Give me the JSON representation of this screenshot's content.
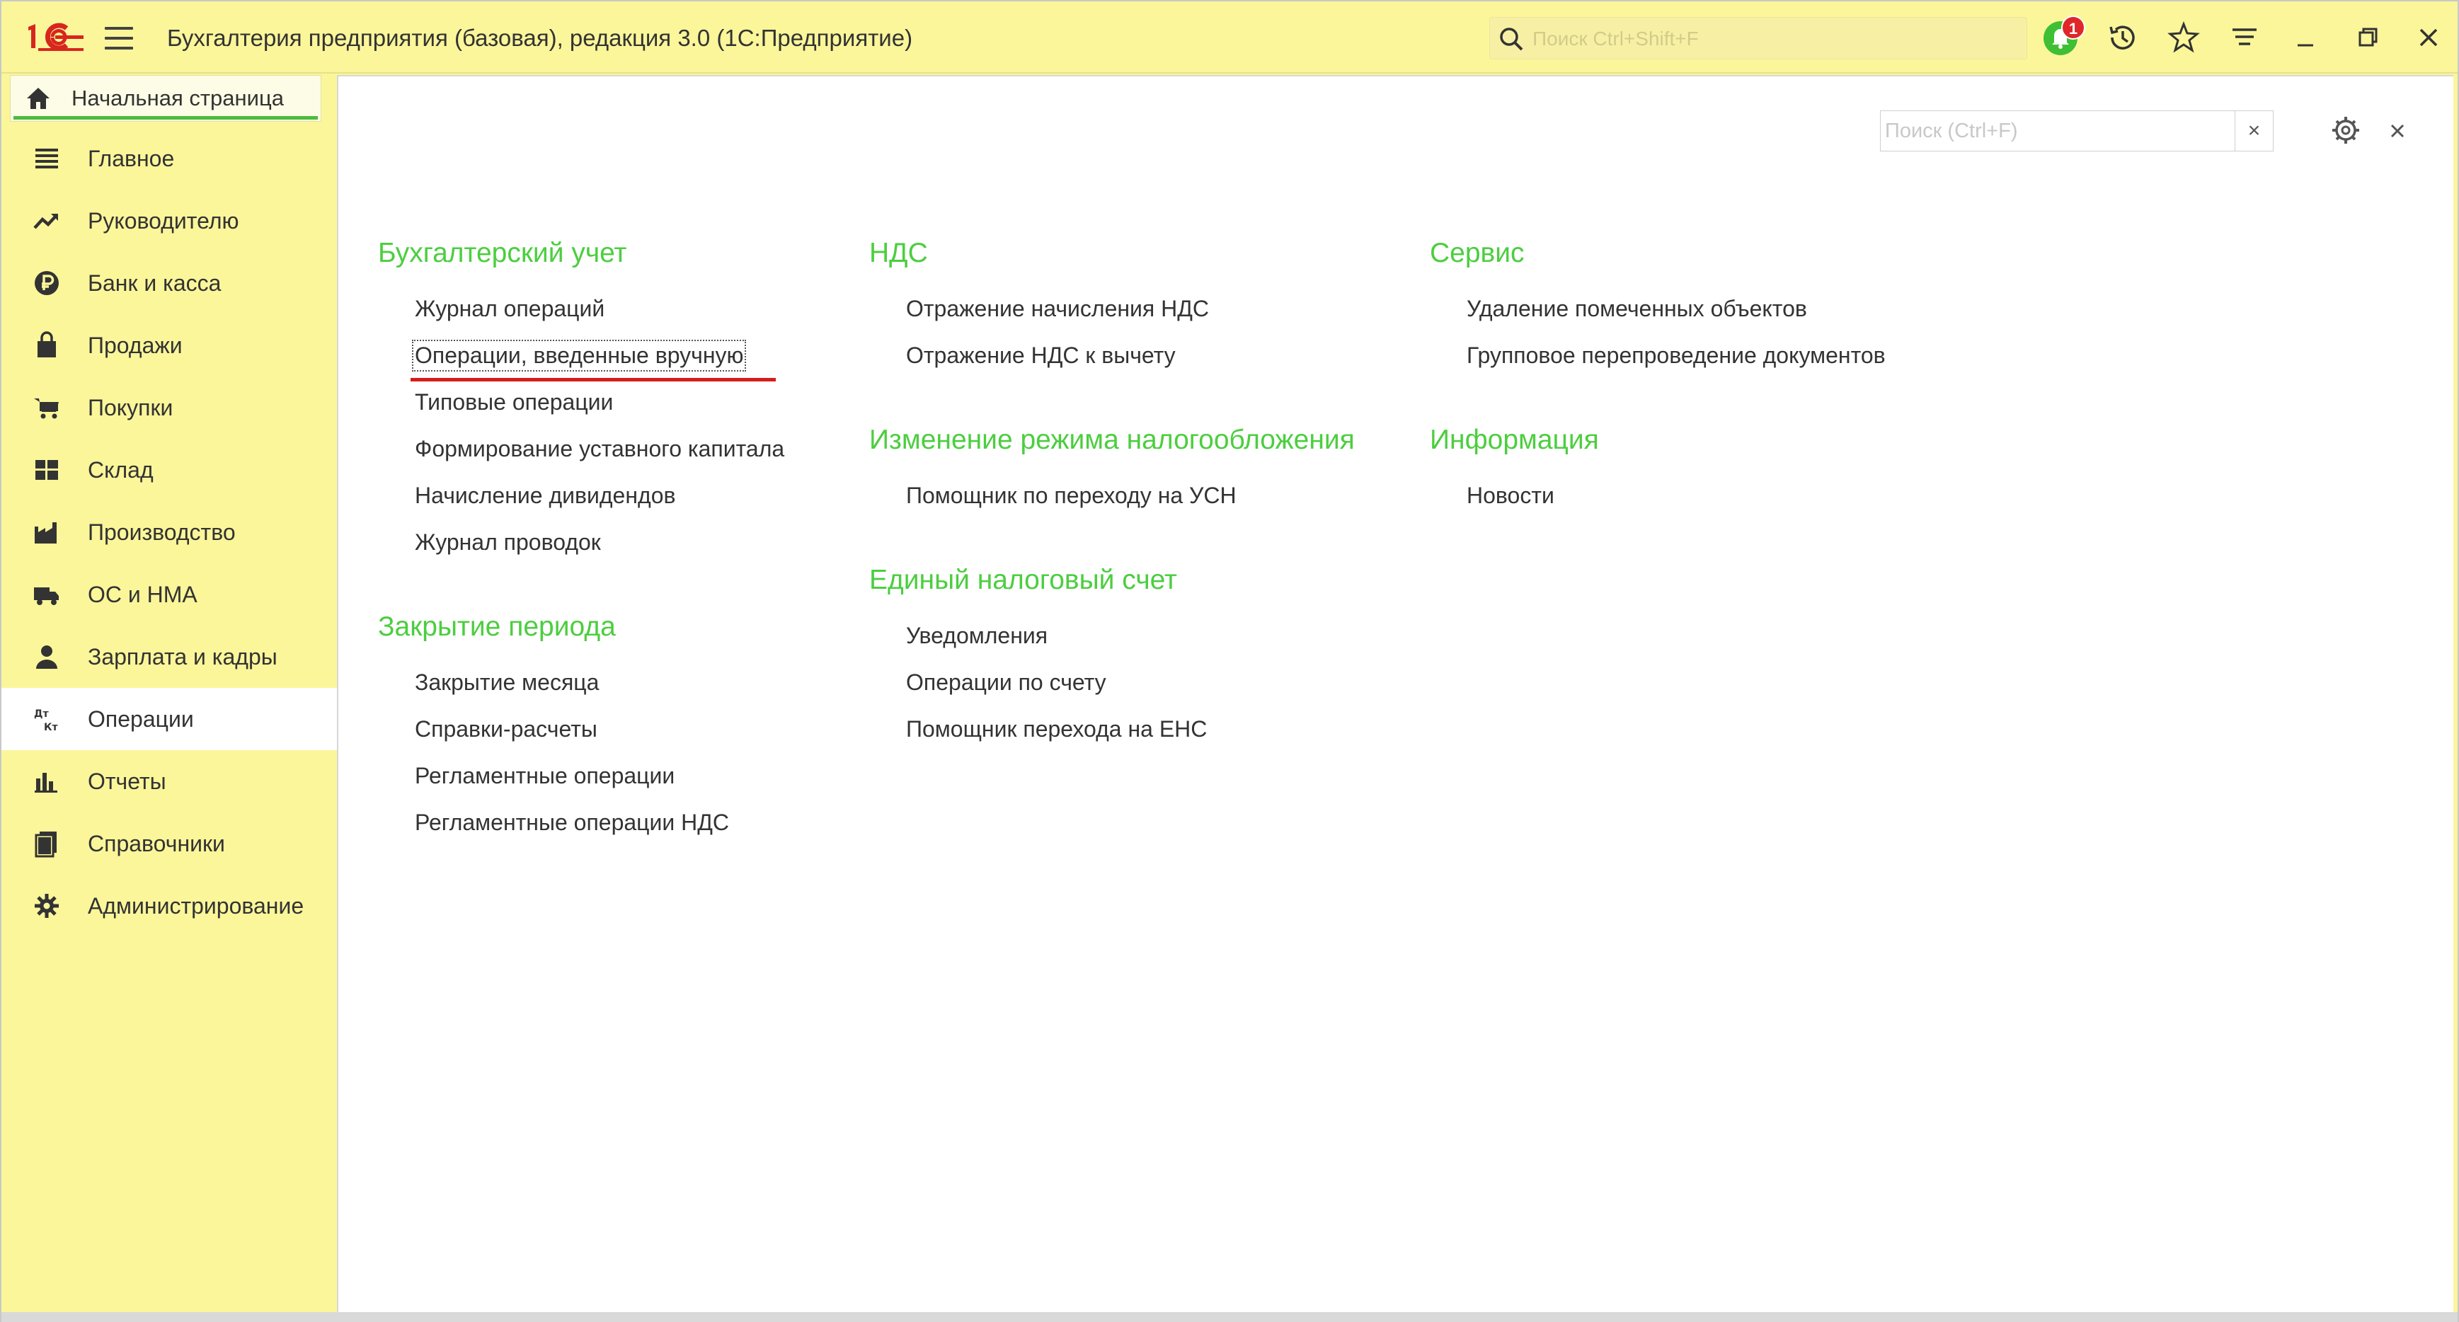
{
  "app": {
    "title": "Бухгалтерия предприятия (базовая), редакция 3.0  (1С:Предприятие)",
    "logo_icon": "1c-logo-icon",
    "search_placeholder": "Поиск Ctrl+Shift+F",
    "notification_count": "1",
    "accent_color": "#4cce3f",
    "toolbar_bg": "#fbf69a"
  },
  "home_tab": {
    "label": "Начальная страница"
  },
  "sidebar": {
    "items": [
      {
        "label": "Главное",
        "icon": "menu-lines-icon"
      },
      {
        "label": "Руководителю",
        "icon": "trend-up-icon"
      },
      {
        "label": "Банк и касса",
        "icon": "ruble-coin-icon"
      },
      {
        "label": "Продажи",
        "icon": "shopping-bag-icon"
      },
      {
        "label": "Покупки",
        "icon": "cart-icon"
      },
      {
        "label": "Склад",
        "icon": "warehouse-grid-icon"
      },
      {
        "label": "Производство",
        "icon": "factory-icon"
      },
      {
        "label": "ОС и НМА",
        "icon": "truck-icon"
      },
      {
        "label": "Зарплата и кадры",
        "icon": "person-icon"
      },
      {
        "label": "Операции",
        "icon": "debit-credit-icon",
        "active": true
      },
      {
        "label": "Отчеты",
        "icon": "bar-chart-icon"
      },
      {
        "label": "Справочники",
        "icon": "books-icon"
      },
      {
        "label": "Администрирование",
        "icon": "gear-icon"
      }
    ]
  },
  "panel": {
    "search_placeholder": "Поиск (Ctrl+F)",
    "clear_label": "×",
    "close_label": "×"
  },
  "sections": {
    "accounting": {
      "title": "Бухгалтерский учет",
      "links": [
        "Журнал операций",
        "Операции, введенные вручную",
        "Типовые операции",
        "Формирование уставного капитала",
        "Начисление дивидендов",
        "Журнал проводок"
      ]
    },
    "period_close": {
      "title": "Закрытие периода",
      "links": [
        "Закрытие месяца",
        "Справки-расчеты",
        "Регламентные операции",
        "Регламентные операции НДС"
      ]
    },
    "vat": {
      "title": "НДС",
      "links": [
        "Отражение начисления НДС",
        "Отражение НДС к вычету"
      ]
    },
    "tax_mode": {
      "title": "Изменение режима налогообложения",
      "links": [
        "Помощник по переходу на УСН"
      ]
    },
    "ens": {
      "title": "Единый налоговый счет",
      "links": [
        "Уведомления",
        "Операции по счету",
        "Помощник перехода на ЕНС"
      ]
    },
    "service": {
      "title": "Сервис",
      "links": [
        "Удаление помеченных объектов",
        "Групповое перепроведение документов"
      ]
    },
    "info": {
      "title": "Информация",
      "links": [
        "Новости"
      ]
    }
  }
}
